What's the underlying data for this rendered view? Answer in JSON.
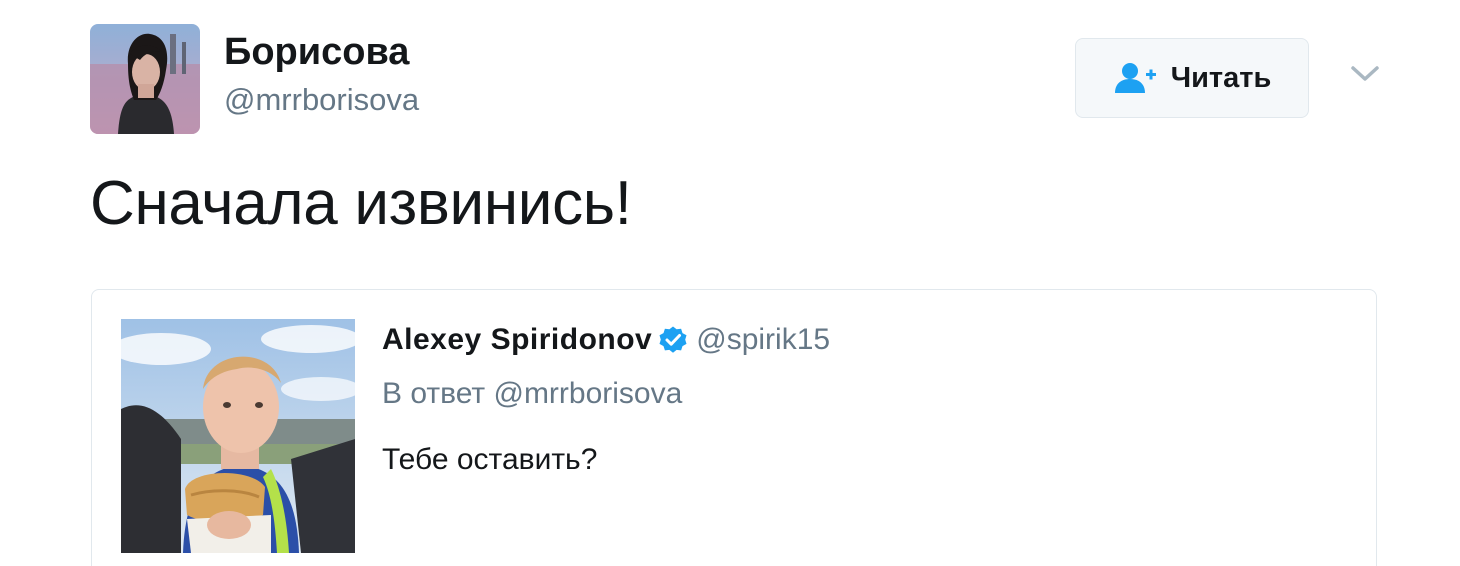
{
  "author": {
    "name": "Борисова",
    "handle": "@mrrborisova"
  },
  "follow_button": {
    "label": "Читать",
    "icon": "add-user-icon"
  },
  "menu": {
    "icon": "chevron-down-icon"
  },
  "tweet": {
    "text": "Сначала извинись!"
  },
  "quoted_tweet": {
    "author_name": "Alexey Spiridonov",
    "verified": true,
    "verified_icon": "verified-badge-icon",
    "handle": "@spirik15",
    "reply_prefix": "В ответ",
    "reply_handle": "@mrrborisova",
    "text": "Тебе оставить?"
  },
  "colors": {
    "text_primary": "#14171a",
    "text_secondary": "#657786",
    "accent_blue": "#1da1f2",
    "border": "#e1e8ed",
    "button_bg": "#f5f8fa"
  }
}
